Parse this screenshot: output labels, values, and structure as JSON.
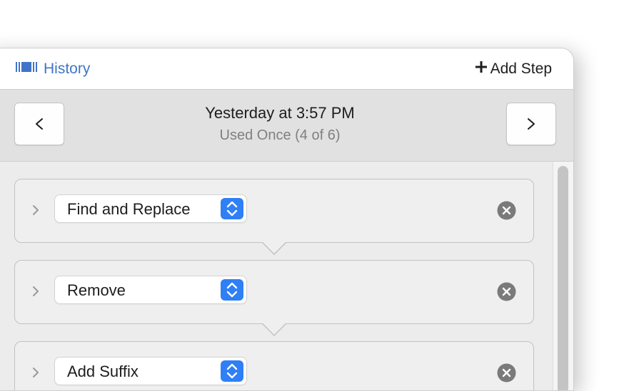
{
  "toolbar": {
    "history_label": "History",
    "history_icon": "library-books-icon",
    "add_step_label": "Add Step",
    "add_step_icon": "plus-icon"
  },
  "navigator": {
    "prev_label": "<",
    "next_label": ">",
    "title": "Yesterday at 3:57 PM",
    "subtitle": "Used Once (4 of 6)"
  },
  "steps": [
    {
      "action": "Find and Replace"
    },
    {
      "action": "Remove"
    },
    {
      "action": "Add Suffix"
    }
  ],
  "colors": {
    "accent": "#2f7ff6",
    "link": "#3f74c9",
    "remove_icon": "#7a7a7a"
  }
}
